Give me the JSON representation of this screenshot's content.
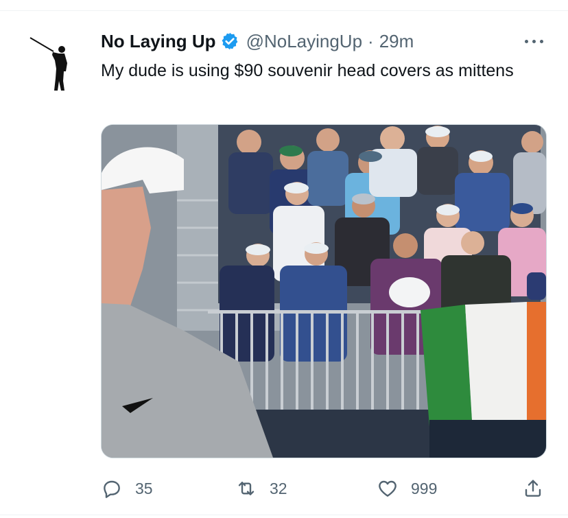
{
  "tweet": {
    "display_name": "No Laying Up",
    "verified_icon": "verified-badge-icon",
    "handle": "@NoLayingUp",
    "separator": "·",
    "time": "29m",
    "text": "My dude is using $90 souvenir head covers as mittens",
    "media_alt_icon": "crowd-photo"
  },
  "actions": {
    "reply_count": "35",
    "retweet_count": "32",
    "like_count": "999",
    "share_icon": "share-icon"
  },
  "colors": {
    "text_primary": "#0f1419",
    "text_secondary": "#536471",
    "verified_blue": "#1d9bf0",
    "divider": "#eff3f4"
  }
}
